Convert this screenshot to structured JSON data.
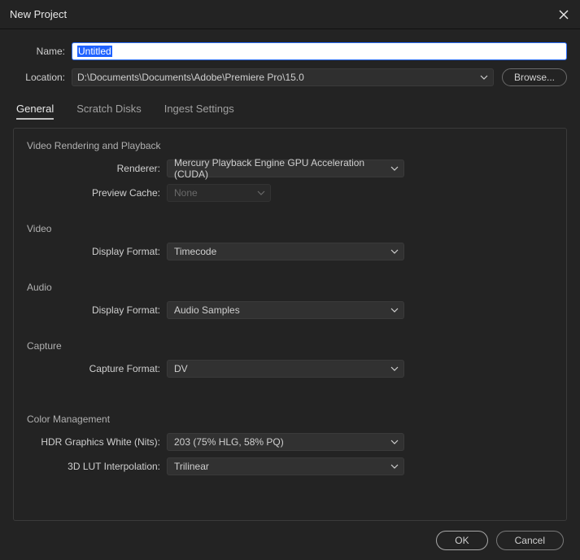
{
  "title": "New Project",
  "fields": {
    "name_label": "Name:",
    "name_value": "Untitled",
    "location_label": "Location:",
    "location_value": "D:\\Documents\\Documents\\Adobe\\Premiere Pro\\15.0",
    "browse_label": "Browse..."
  },
  "tabs": {
    "general": "General",
    "scratch": "Scratch Disks",
    "ingest": "Ingest Settings"
  },
  "groups": {
    "rendering": {
      "title": "Video Rendering and Playback",
      "renderer_label": "Renderer:",
      "renderer_value": "Mercury Playback Engine GPU Acceleration (CUDA)",
      "preview_cache_label": "Preview Cache:",
      "preview_cache_value": "None"
    },
    "video": {
      "title": "Video",
      "display_format_label": "Display Format:",
      "display_format_value": "Timecode"
    },
    "audio": {
      "title": "Audio",
      "display_format_label": "Display Format:",
      "display_format_value": "Audio Samples"
    },
    "capture": {
      "title": "Capture",
      "capture_format_label": "Capture Format:",
      "capture_format_value": "DV"
    },
    "color": {
      "title": "Color Management",
      "hdr_label": "HDR Graphics White (Nits):",
      "hdr_value": "203 (75% HLG, 58% PQ)",
      "lut_label": "3D LUT Interpolation:",
      "lut_value": "Trilinear"
    }
  },
  "footer": {
    "ok": "OK",
    "cancel": "Cancel"
  }
}
